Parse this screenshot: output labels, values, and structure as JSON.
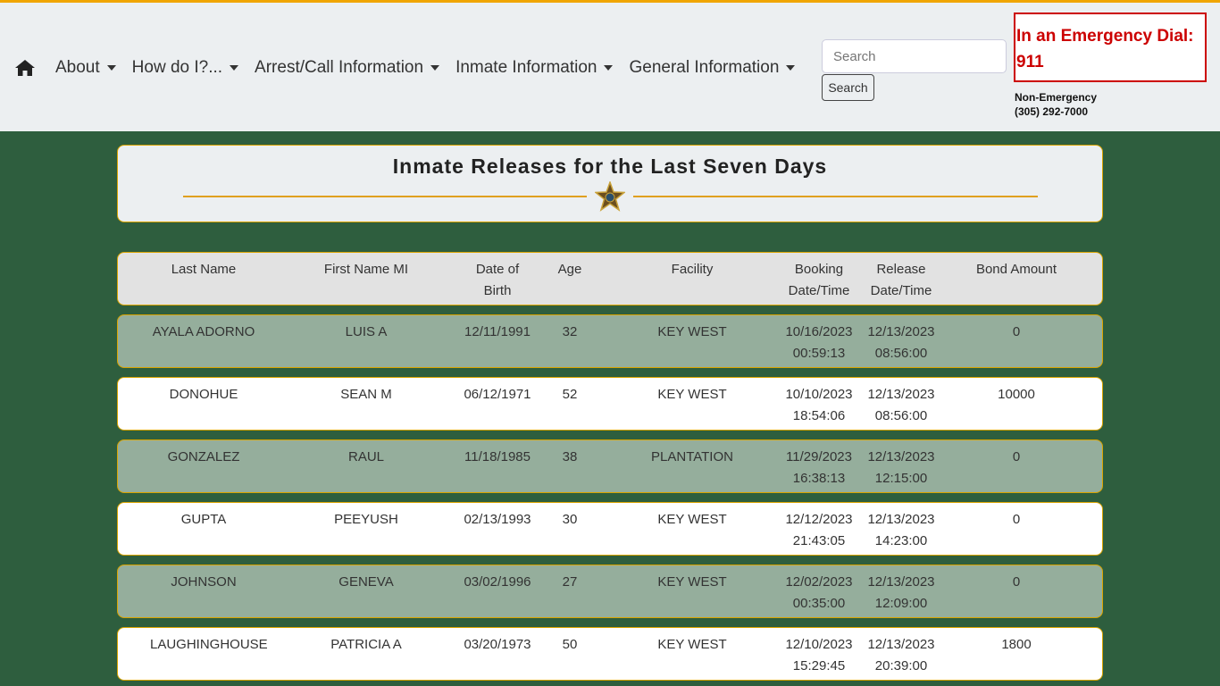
{
  "nav": {
    "items": [
      "About",
      "How do I?...",
      "Arrest/Call Information",
      "Inmate Information",
      "General Information"
    ]
  },
  "search": {
    "placeholder": "Search",
    "button_label": "Search"
  },
  "emergency": {
    "line1": "In an Emergency Dial:",
    "line2": "911",
    "non_label": "Non-Emergency",
    "non_number": "(305) 292-7000"
  },
  "page": {
    "title": "Inmate Releases for the Last Seven Days"
  },
  "colors": {
    "accent": "#f0a500",
    "background": "#2e5e3e",
    "alt_row": "#95ae9c",
    "emergency": "#cc0000"
  },
  "table": {
    "headers": [
      [
        "Last Name"
      ],
      [
        "First Name MI"
      ],
      [
        "Date of",
        "Birth"
      ],
      [
        "Age"
      ],
      [
        "Facility"
      ],
      [
        "Booking",
        "Date/Time"
      ],
      [
        "Release",
        "Date/Time"
      ],
      [
        "Bond Amount"
      ]
    ],
    "rows": [
      [
        "AYALA ADORNO",
        "LUIS A",
        "12/11/1991",
        "32",
        "KEY WEST",
        [
          "10/16/2023",
          "00:59:13"
        ],
        [
          "12/13/2023",
          "08:56:00"
        ],
        "0"
      ],
      [
        "DONOHUE",
        "SEAN M",
        "06/12/1971",
        "52",
        "KEY WEST",
        [
          "10/10/2023",
          "18:54:06"
        ],
        [
          "12/13/2023",
          "08:56:00"
        ],
        "10000"
      ],
      [
        "GONZALEZ",
        "RAUL",
        "11/18/1985",
        "38",
        "PLANTATION",
        [
          "11/29/2023",
          "16:38:13"
        ],
        [
          "12/13/2023",
          "12:15:00"
        ],
        "0"
      ],
      [
        "GUPTA",
        "PEEYUSH",
        "02/13/1993",
        "30",
        "KEY WEST",
        [
          "12/12/2023",
          "21:43:05"
        ],
        [
          "12/13/2023",
          "14:23:00"
        ],
        "0"
      ],
      [
        "JOHNSON",
        "GENEVA",
        "03/02/1996",
        "27",
        "KEY WEST",
        [
          "12/02/2023",
          "00:35:00"
        ],
        [
          "12/13/2023",
          "12:09:00"
        ],
        "0"
      ],
      [
        "LAUGHINGHOUSE",
        "PATRICIA A",
        "03/20/1973",
        "50",
        "KEY WEST",
        [
          "12/10/2023",
          "15:29:45"
        ],
        [
          "12/13/2023",
          "20:39:00"
        ],
        "1800"
      ]
    ]
  }
}
